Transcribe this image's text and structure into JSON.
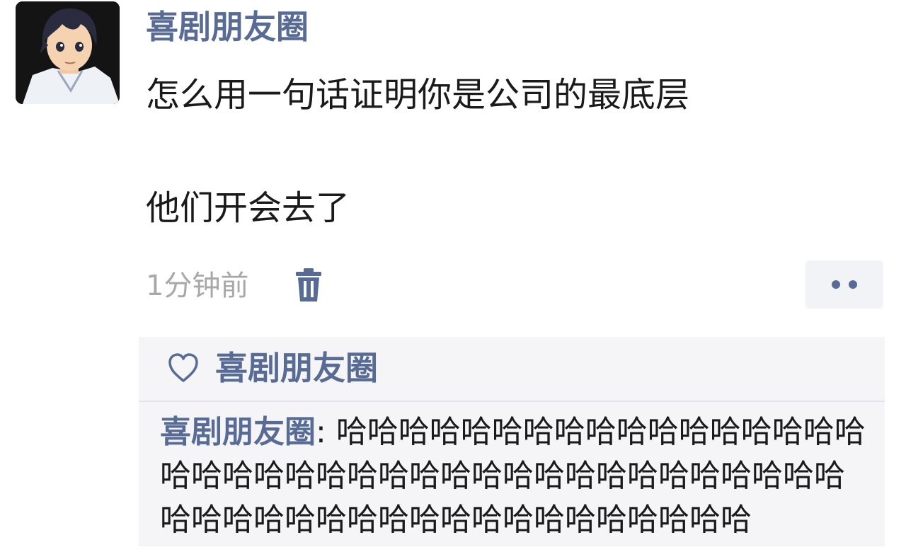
{
  "post": {
    "author": "喜剧朋友圈",
    "content_line1": "怎么用一句话证明你是公司的最底层",
    "content_line2": "他们开会去了",
    "time": "1分钟前",
    "icons": {
      "delete": "trash-icon",
      "more": "more-dots-icon",
      "like": "heart-icon"
    }
  },
  "likes": {
    "names": "喜剧朋友圈"
  },
  "comments": [
    {
      "author": "喜剧朋友圈",
      "separator": ": ",
      "text": "哈哈哈哈哈哈哈哈哈哈哈哈哈哈哈哈哈哈哈哈哈哈哈哈哈哈哈哈哈哈哈哈哈哈哈哈哈哈哈哈哈哈哈哈哈哈哈哈哈哈哈哈哈哈哈哈哈哈"
    }
  ],
  "colors": {
    "link": "#576b95",
    "text": "#1a1a1a",
    "muted": "#a8a8a8",
    "panel": "#f5f5f7"
  }
}
